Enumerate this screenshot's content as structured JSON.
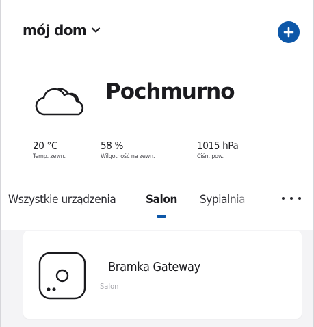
{
  "header": {
    "home_name": "mój dom",
    "home_dropdown_icon": "chevron-down-icon",
    "add_icon": "plus-icon",
    "accent_color": "#0d57a8"
  },
  "weather": {
    "icon": "cloud-icon",
    "condition": "Pochmurno",
    "stats": [
      {
        "value": "20 °C",
        "label": "Temp. zewn."
      },
      {
        "value": "58 %",
        "label": "Wilgotność na zewn."
      },
      {
        "value": "1015 hPa",
        "label": "Ciśn. pow."
      }
    ]
  },
  "tabs": {
    "items": [
      {
        "label": "Wszystkie urządzenia",
        "active": false
      },
      {
        "label": "Salon",
        "active": true
      },
      {
        "label": "Sypialnia",
        "active": false
      }
    ],
    "more_icon": "more-horizontal-icon"
  },
  "devices": [
    {
      "name": "Bramka Gateway",
      "room": "Salon",
      "icon": "gateway-icon"
    }
  ]
}
